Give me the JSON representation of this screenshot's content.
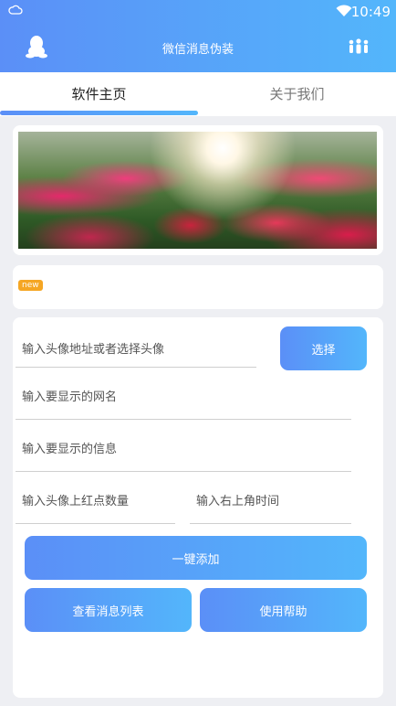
{
  "status_bar": {
    "time": "10:49"
  },
  "header": {
    "title": "微信消息伪装"
  },
  "tabs": [
    {
      "label": "软件主页"
    },
    {
      "label": "关于我们"
    }
  ],
  "notice": {
    "badge": "new"
  },
  "form": {
    "avatar_placeholder": "输入头像地址或者选择头像",
    "select_label": "选择",
    "nickname_placeholder": "输入要显示的网名",
    "message_placeholder": "输入要显示的信息",
    "red_dot_placeholder": "输入头像上红点数量",
    "time_placeholder": "输入右上角时间",
    "add_label": "一键添加",
    "list_label": "查看消息列表",
    "help_label": "使用帮助"
  },
  "colors": {
    "accent_start": "#5b8ff7",
    "accent_end": "#53b6fb",
    "badge": "#f5a623"
  },
  "icons": [
    "cloud-icon",
    "wifi-icon",
    "qq-penguin-icon",
    "people-group-icon"
  ]
}
